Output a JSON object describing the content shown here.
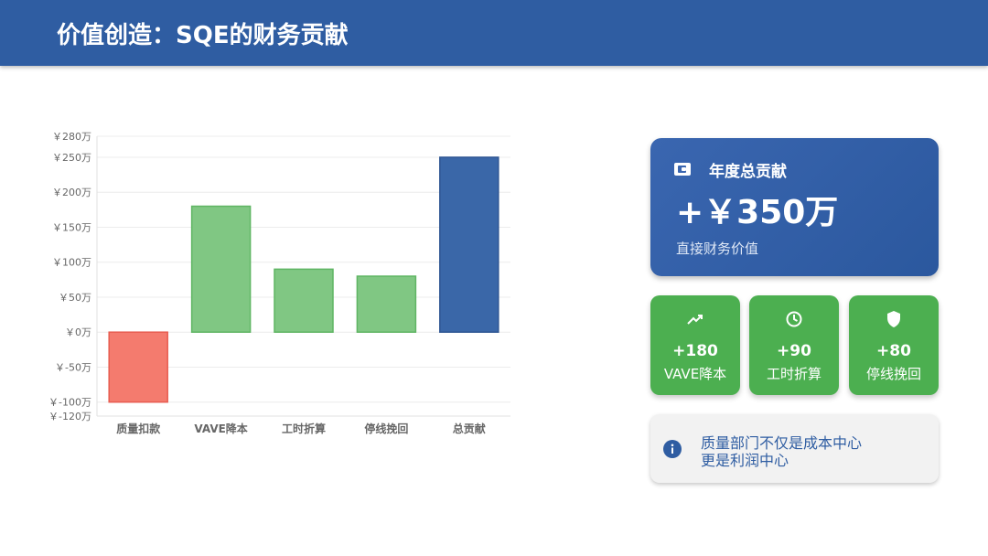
{
  "header": {
    "title": "价值创造：SQE的财务贡献"
  },
  "colors": {
    "header": "#2f5da2",
    "negative": "#f47b6e",
    "positive": "#80c783",
    "total": "#3a67a8",
    "card_green": "#4caf50"
  },
  "chart_data": {
    "type": "bar",
    "subtype": "waterfall",
    "categories": [
      "质量扣款",
      "VAVE降本",
      "工时折算",
      "停线挽回",
      "总贡献"
    ],
    "values": [
      -100,
      180,
      90,
      80,
      250
    ],
    "ylim": [
      -120,
      280
    ],
    "yticks": [
      {
        "v": 280,
        "label": "￥280万"
      },
      {
        "v": 250,
        "label": "￥250万"
      },
      {
        "v": 200,
        "label": "￥200万"
      },
      {
        "v": 150,
        "label": "￥150万"
      },
      {
        "v": 100,
        "label": "￥100万"
      },
      {
        "v": 50,
        "label": "￥50万"
      },
      {
        "v": 0,
        "label": "￥0万"
      },
      {
        "v": -50,
        "label": "￥-50万"
      },
      {
        "v": -100,
        "label": "￥-100万"
      },
      {
        "v": -120,
        "label": "￥-120万"
      }
    ],
    "bar_colors": [
      "#f47b6e",
      "#80c783",
      "#80c783",
      "#80c783",
      "#3a67a8"
    ],
    "bar_strokes": [
      "#e85c50",
      "#5fb563",
      "#5fb563",
      "#5fb563",
      "#2f5693"
    ],
    "grid": true,
    "legend": "none"
  },
  "total_card": {
    "icon": "wallet-icon",
    "title": "年度总贡献",
    "value": "+￥350万",
    "subtitle": "直接财务价值"
  },
  "metrics": [
    {
      "icon": "trend-up-icon",
      "value": "+180",
      "label": "VAVE降本"
    },
    {
      "icon": "clock-icon",
      "value": "+90",
      "label": "工时折算"
    },
    {
      "icon": "shield-icon",
      "value": "+80",
      "label": "停线挽回"
    }
  ],
  "note": {
    "icon": "info-icon",
    "line1": "质量部门不仅是成本中心",
    "line2": "更是利润中心"
  }
}
